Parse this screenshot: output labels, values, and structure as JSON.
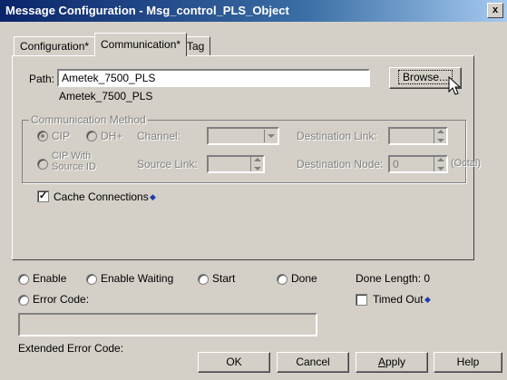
{
  "window": {
    "title": "Message Configuration - Msg_control_PLS_Object",
    "close_label": "x"
  },
  "tabs": [
    {
      "label": "Configuration*"
    },
    {
      "label": "Communication*"
    },
    {
      "label": "Tag"
    }
  ],
  "path": {
    "label": "Path:",
    "value": "Ametek_7500_PLS",
    "resolved": "Ametek_7500_PLS",
    "browse_label": "Browse..."
  },
  "comm_method": {
    "legend": "Communication Method",
    "cip_label": "CIP",
    "cip_selected": true,
    "dhplus_label": "DH+",
    "channel_label": "Channel:",
    "destination_link_label": "Destination Link:",
    "cip_with_source_id_label_1": "CIP With",
    "cip_with_source_id_label_2": "Source ID",
    "source_link_label": "Source Link:",
    "destination_node_label": "Destination Node:",
    "destination_node_value": "0",
    "octal_label": "(Octal)"
  },
  "cache": {
    "label": "Cache Connections",
    "checked": true,
    "check_mark": "✓",
    "arrow": "◆"
  },
  "status": {
    "enable": "Enable",
    "enable_waiting": "Enable Waiting",
    "start": "Start",
    "done": "Done",
    "done_length": "Done Length: 0",
    "error_code": "Error Code:",
    "timed_out": "Timed Out",
    "timed_out_arrow": "◆",
    "extended_error_code": "Extended Error Code:"
  },
  "buttons": {
    "ok": "OK",
    "cancel": "Cancel",
    "apply": "Apply",
    "help": "Help"
  },
  "colors": {
    "title_bar": "#0a246a",
    "face": "#d4d0c8",
    "arrow_accent": "#1e3fa8"
  }
}
